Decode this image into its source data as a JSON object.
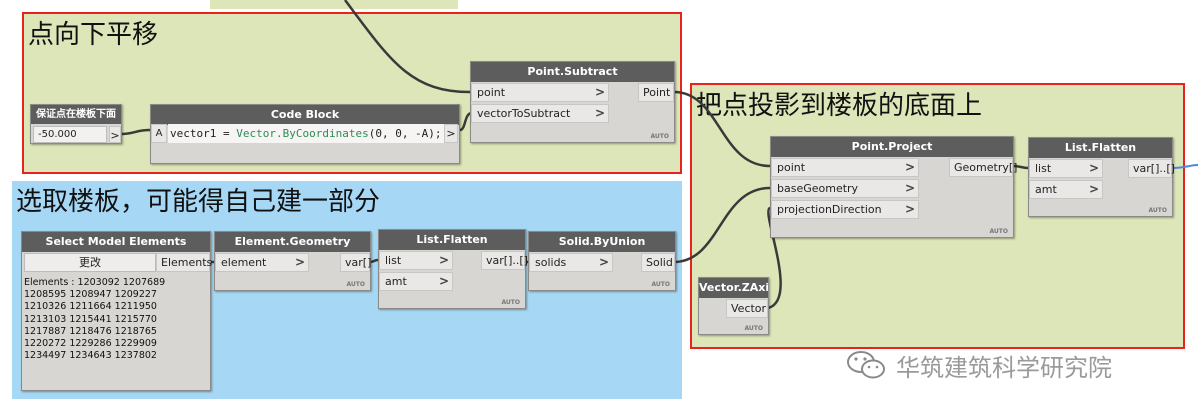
{
  "colors": {
    "green_group": "#dde6b8",
    "blue_group": "#a6d8f5",
    "red_border": "#e8231d",
    "node_header": "#5d5d5d",
    "wire": "#3a3a3a",
    "output_wire": "#4f86d9"
  },
  "groups": {
    "move_down_title": "点向下平移",
    "project_title": "把点投影到楼板的底面上",
    "select_title": "选取楼板，可能得自己建一部分"
  },
  "nodes": {
    "ensure_below": {
      "title": "保证点在楼板下面",
      "value": "-50.000",
      "out_arrow": ">"
    },
    "code_block": {
      "title": "Code Block",
      "input_label": "A",
      "code_prefix": "vector1 = ",
      "code_class": "Vector",
      "code_method": ".ByCoordinates",
      "code_args": "(0, 0, -A);",
      "out_arrow": ">"
    },
    "point_subtract": {
      "title": "Point.Subtract",
      "inputs": [
        "point",
        "vectorToSubtract"
      ],
      "output": "Point",
      "auto": "AUTO"
    },
    "point_project": {
      "title": "Point.Project",
      "inputs": [
        "point",
        "baseGeometry",
        "projectionDirection"
      ],
      "output": "Geometry[]",
      "auto": "AUTO"
    },
    "list_flatten_top": {
      "title": "List.Flatten",
      "inputs": [
        "list",
        "amt"
      ],
      "output": "var[]..[]",
      "auto": "AUTO"
    },
    "vector_zaxis": {
      "title": "Vector.ZAxis",
      "output": "Vector",
      "auto": "AUTO"
    },
    "select_model": {
      "title": "Select Model Elements",
      "button": "更改",
      "output": "Elements",
      "list_text": "Elements : 1203092 1207689\n1208595 1208947 1209227\n1210326 1211664 1211950\n1213103 1215441 1215770\n1217887 1218476 1218765\n1220272 1229286 1229909\n1234497 1234643 1237802"
    },
    "element_geometry": {
      "title": "Element.Geometry",
      "input": "element",
      "output": "var[]",
      "auto": "AUTO"
    },
    "list_flatten_bottom": {
      "title": "List.Flatten",
      "inputs": [
        "list",
        "amt"
      ],
      "output": "var[]..[]",
      "auto": "AUTO"
    },
    "solid_byunion": {
      "title": "Solid.ByUnion",
      "input": "solids",
      "output": "Solid",
      "auto": "AUTO"
    }
  },
  "watermark": {
    "icon": "wechat-icon",
    "text": "华筑建筑科学研究院"
  }
}
